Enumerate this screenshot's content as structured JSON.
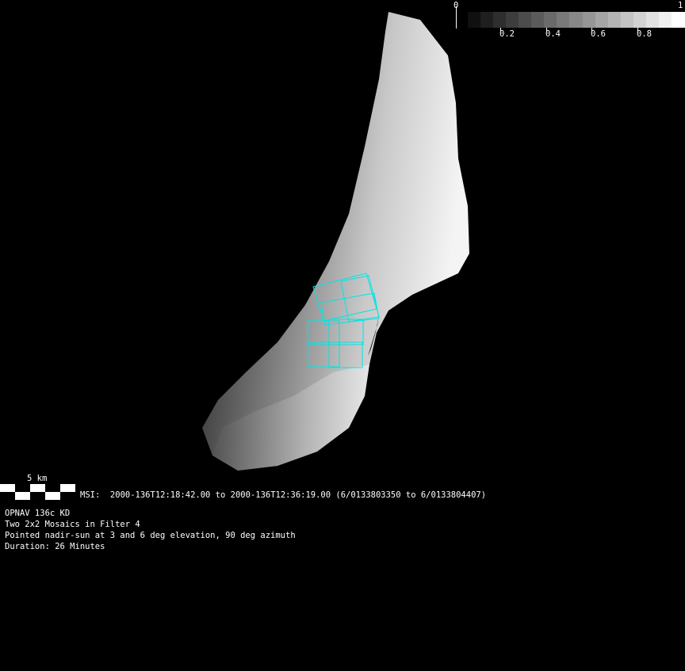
{
  "colorbar": {
    "min_label": "0",
    "max_label": "1",
    "ticks": [
      "0.2",
      "0.4",
      "0.6",
      "0.8"
    ],
    "steps": 17
  },
  "scale_bar": {
    "label": "5 km"
  },
  "msi_line": "MSI:  2000-136T12:18:42.00 to 2000-136T12:36:19.00 (6/0133803350 to 6/0133804407)",
  "info": [
    "OPNAV 136c KD",
    "Two 2x2 Mosaics in Filter 4",
    "Pointed nadir-sun at 3 and 6 deg elevation, 90 deg azimuth",
    "Duration: 26 Minutes"
  ],
  "colors": {
    "footprint": "#00e5e5",
    "background": "#000000"
  }
}
